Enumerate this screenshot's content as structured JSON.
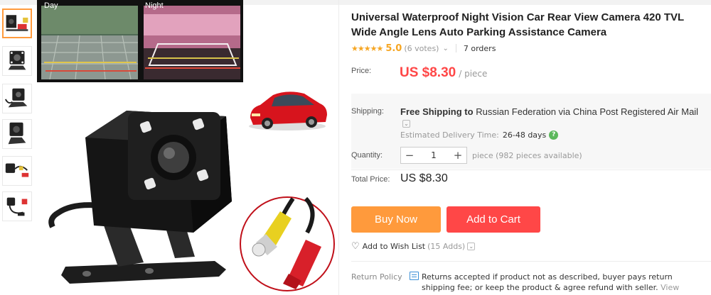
{
  "gallery": {
    "day_label": "Day",
    "night_label": "Night",
    "thumbnails": [
      "thumb-1",
      "thumb-2",
      "thumb-3",
      "thumb-4",
      "thumb-5",
      "thumb-6"
    ]
  },
  "product": {
    "title": "Universal Waterproof Night Vision Car Rear View Camera 420 TVL Wide Angle Lens Auto Parking Assistance Camera",
    "stars": "★★★★★",
    "rating": "5.0",
    "votes": "(6 votes)",
    "orders": "7 orders"
  },
  "price": {
    "label": "Price:",
    "value": "US $8.30",
    "unit": "/ piece"
  },
  "shipping": {
    "label": "Shipping:",
    "free": "Free Shipping",
    "to": "to",
    "destination": "Russian Federation via China Post Registered Air Mail",
    "delivery_label": "Estimated Delivery Time:",
    "delivery_days": "26-48  days"
  },
  "quantity": {
    "label": "Quantity:",
    "minus": "−",
    "value": "1",
    "plus": "+",
    "available": "piece (982 pieces available)"
  },
  "total": {
    "label": "Total Price:",
    "value": "US $8.30"
  },
  "actions": {
    "buy_now": "Buy Now",
    "add_to_cart": "Add to Cart",
    "wishlist": "Add to Wish List",
    "wishlist_count": "(15 Adds)"
  },
  "return_policy": {
    "label": "Return Policy",
    "text": "Returns accepted if product not as described, buyer pays return shipping fee; or keep the product & agree refund with seller.",
    "view_details": "View details"
  },
  "colors": {
    "accent_orange": "#ff9a3c",
    "accent_red": "#ff4747",
    "star": "#f6a623"
  }
}
